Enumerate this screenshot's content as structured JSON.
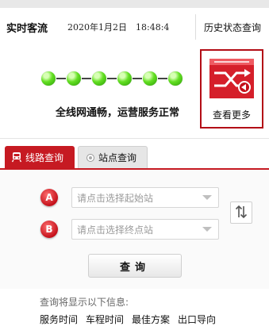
{
  "header": {
    "title": "实时客流",
    "datetime": "2020年1月2日　18:48:4",
    "history_link": "历史状态查询"
  },
  "status": {
    "message": "全线网通畅，运营服务正常",
    "station_dot_count": 6,
    "dot_color": "#3cc10f",
    "more_label": "查看更多"
  },
  "tabs": [
    {
      "label": "线路查询",
      "active": true
    },
    {
      "label": "站点查询",
      "active": false
    }
  ],
  "form": {
    "start_badge": "A",
    "start_placeholder": "请点击选择起始站",
    "end_badge": "B",
    "end_placeholder": "请点击选择终点站",
    "query_button": "查询"
  },
  "info": {
    "title": "查询将显示以下信息:",
    "items": [
      "服务时间",
      "车程时间",
      "最佳方案",
      "出口导向"
    ]
  },
  "colors": {
    "brand_red": "#c61a22",
    "dark_red": "#b30d16"
  }
}
